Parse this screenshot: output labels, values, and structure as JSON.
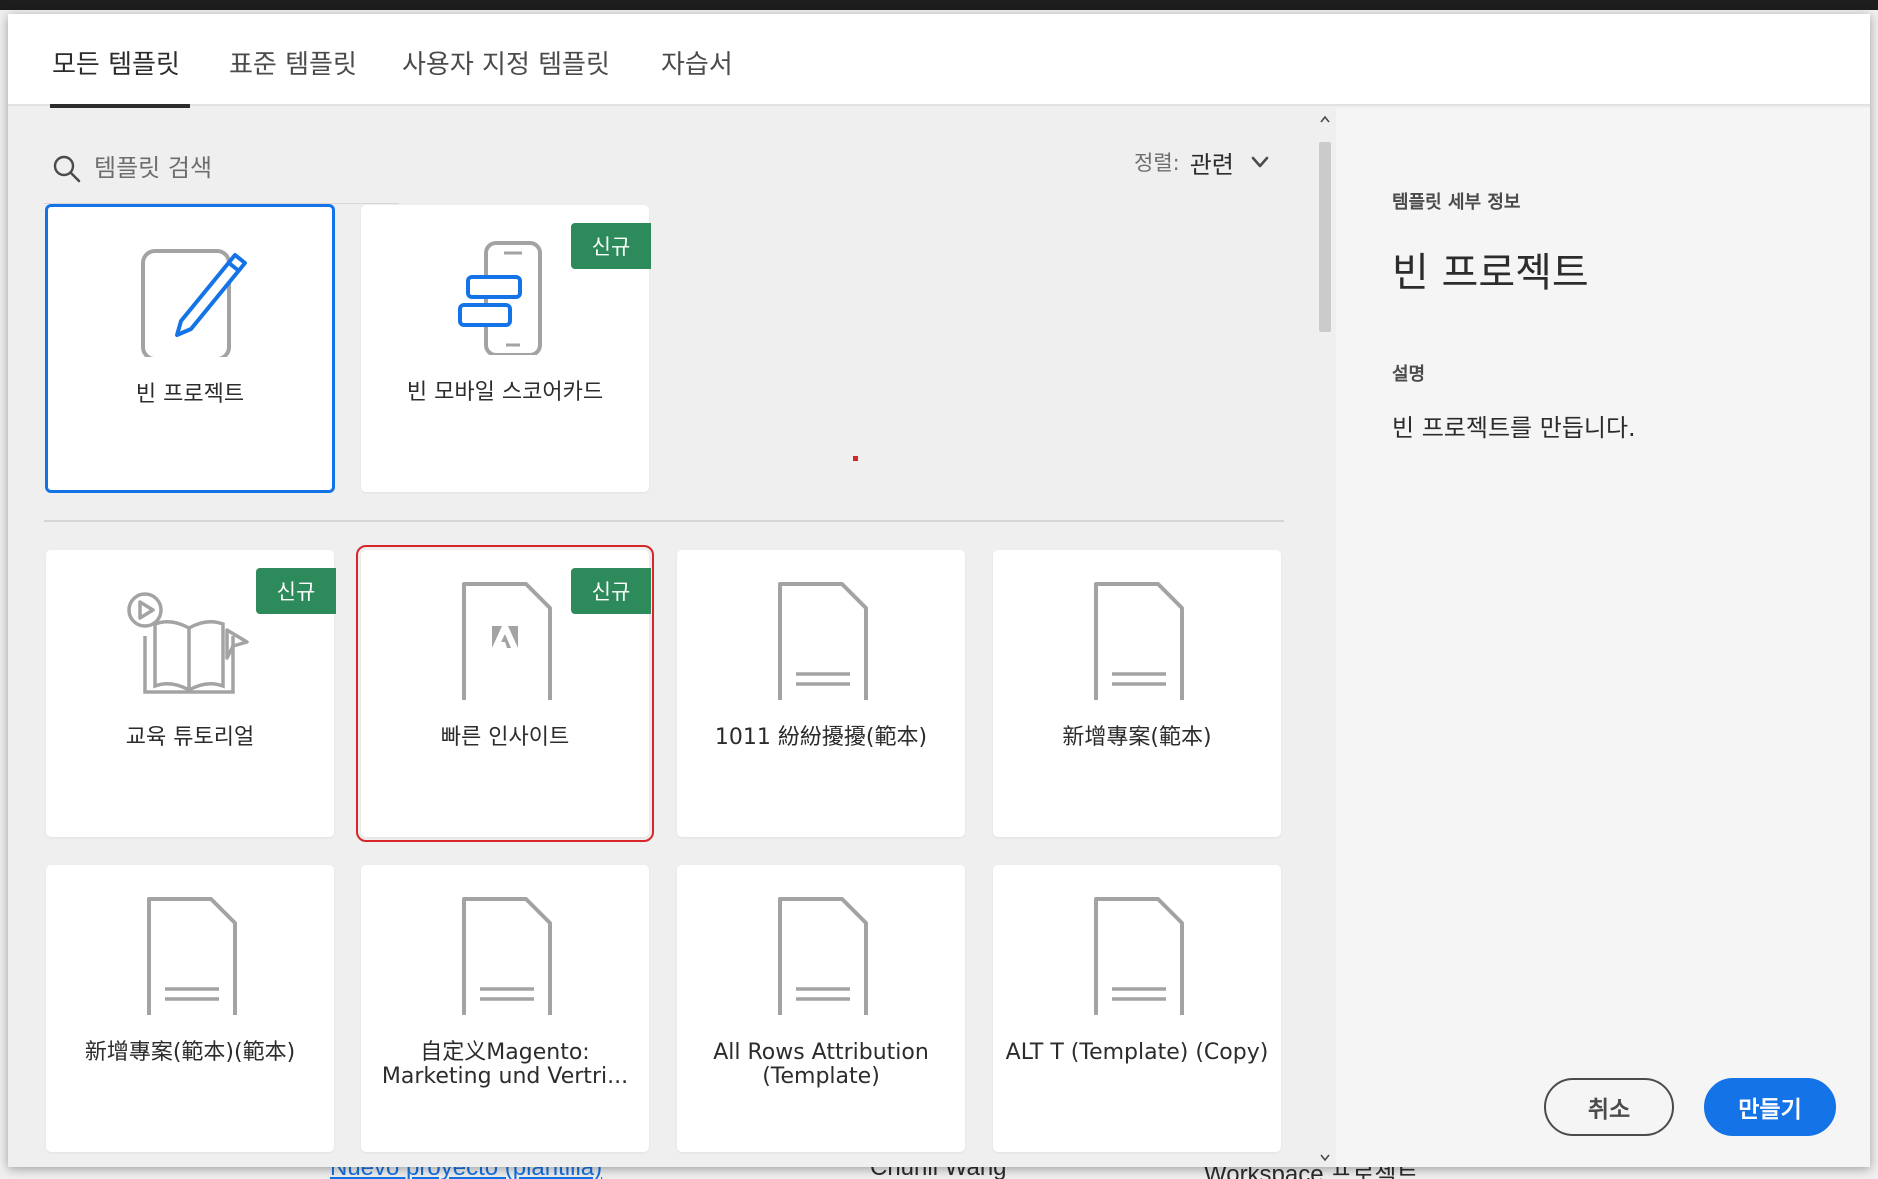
{
  "tabs": [
    {
      "label": "모든 템플릿",
      "selected": true
    },
    {
      "label": "표준 템플릿",
      "selected": false
    },
    {
      "label": "사용자 지정 템플릿",
      "selected": false
    },
    {
      "label": "자습서",
      "selected": false
    }
  ],
  "search": {
    "placeholder": "템플릿 검색",
    "value": ""
  },
  "sort": {
    "label": "정렬:",
    "value": "관련"
  },
  "badge_label": "신규",
  "featured_templates": [
    {
      "name": "빈 프로젝트",
      "icon": "pencil-document-icon",
      "badge": false,
      "selected": true
    },
    {
      "name": "빈 모바일 스코어카드",
      "icon": "mobile-scorecard-icon",
      "badge": true,
      "selected": false
    }
  ],
  "templates": [
    {
      "name": "교육 튜토리얼",
      "icon": "tutorial-book-icon",
      "badge": true
    },
    {
      "name": "빠른 인사이트",
      "icon": "adobe-document-icon",
      "badge": true,
      "highlighted": true
    },
    {
      "name": "1011 紛紛擾擾(範本)",
      "icon": "document-icon",
      "badge": false
    },
    {
      "name": "新增專案(範本)",
      "icon": "document-icon",
      "badge": false
    },
    {
      "name": "新增專案(範本)(範本)",
      "icon": "document-icon",
      "badge": false
    },
    {
      "name": "自定义Magento: Marketing und Vertri...",
      "icon": "document-icon",
      "badge": false
    },
    {
      "name": "All Rows Attribution (Template)",
      "icon": "document-icon",
      "badge": false
    },
    {
      "name": "ALT T (Template) (Copy)",
      "icon": "document-icon",
      "badge": false
    }
  ],
  "details": {
    "heading": "템플릿 세부 정보",
    "title": "빈 프로젝트",
    "description_label": "설명",
    "description": "빈 프로젝트를 만듭니다."
  },
  "buttons": {
    "cancel": "취소",
    "create": "만들기"
  },
  "background": {
    "row": [
      "Nuevo proyecto (plantilla)",
      "Chunli Wang",
      "Workspace 프로젝트"
    ]
  },
  "colors": {
    "accent": "#1473e6",
    "badge": "#2d8a5a",
    "highlight": "#d7262a"
  }
}
